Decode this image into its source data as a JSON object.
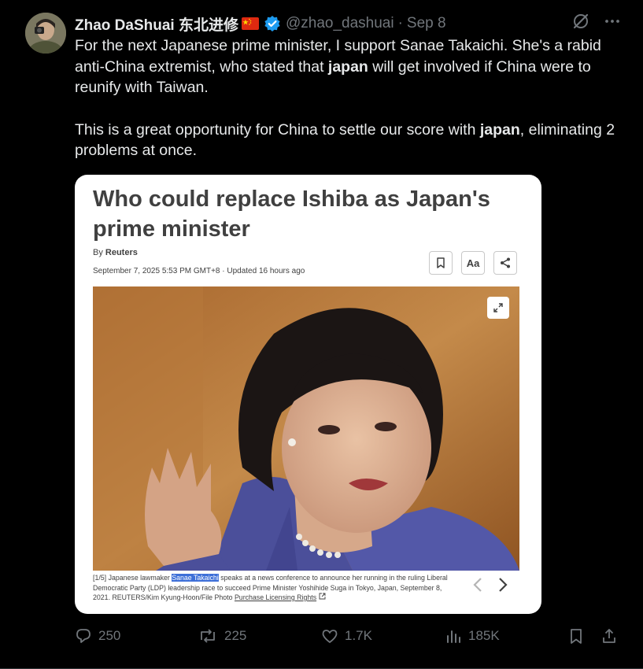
{
  "author": {
    "name": "Zhao DaShuai 东北进修",
    "handle": "@zhao_dashuai",
    "separator": "·",
    "date": "Sep 8"
  },
  "tweet": {
    "p1_a": "For the next Japanese prime minister, I support Sanae Takaichi. She's a rabid anti-China extremist, who stated that ",
    "p1_b": "japan",
    "p1_c": " will get involved if China were to reunify with Taiwan.",
    "p2_a": "This is a great opportunity for China to settle our score with ",
    "p2_b": "japan",
    "p2_c": ", eliminating 2 problems at once."
  },
  "card": {
    "title": "Who could replace Ishiba as Japan's prime minister",
    "byline_prefix": "By ",
    "byline_source": "Reuters",
    "dateline": "September 7, 2025 5:53 PM GMT+8 · Updated 16 hours ago",
    "text_size_label": "Aa",
    "caption_index": "[1/5]",
    "caption_a": " Japanese lawmaker ",
    "caption_highlight": "Sanae Takaichi",
    "caption_b": " speaks at a news conference to announce her running in the ruling Liberal Democratic Party (LDP) leadership race to succeed Prime Minister Yoshihide Suga in Tokyo, Japan, September 8, 2021. REUTERS/Kim Kyung-Hoon/File Photo ",
    "caption_link": "Purchase Licensing Rights"
  },
  "actions": {
    "replies": "250",
    "reposts": "225",
    "likes": "1.7K",
    "views": "185K"
  },
  "colors": {
    "background": "#000000",
    "text": "#e7e9ea",
    "muted": "#71767b",
    "verified": "#1d9bf0",
    "highlight": "#3d6fd8"
  }
}
